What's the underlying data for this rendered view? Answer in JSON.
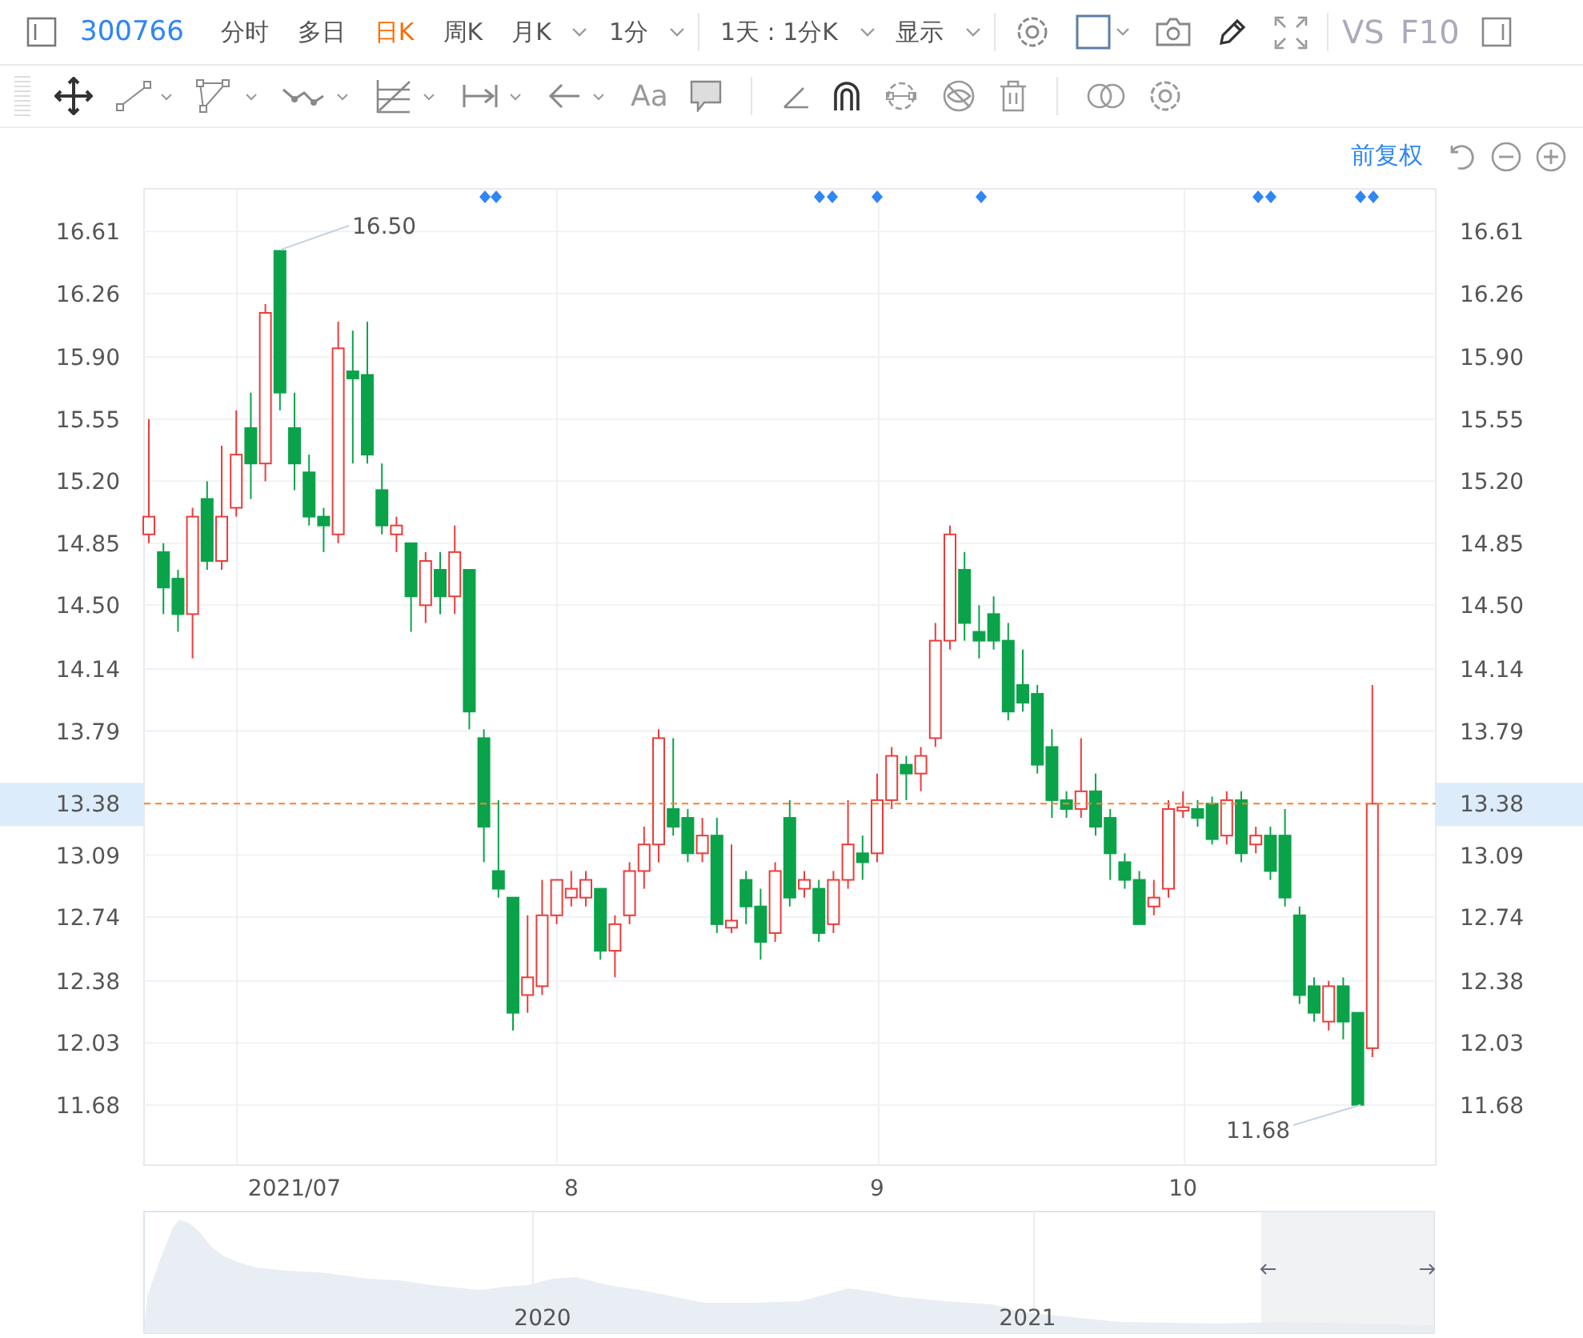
{
  "toolbar": {
    "stock_code": "300766",
    "periods": [
      {
        "label": "分时",
        "selected": false,
        "kind": "tab"
      },
      {
        "label": "多日",
        "selected": false,
        "kind": "tab"
      },
      {
        "label": "日K",
        "selected": true,
        "kind": "tab"
      },
      {
        "label": "周K",
        "selected": false,
        "kind": "tab"
      },
      {
        "label": "月K",
        "selected": false,
        "kind": "dropdown"
      },
      {
        "label": "1分",
        "selected": false,
        "kind": "dropdown"
      }
    ],
    "range": "1天 : 1分K",
    "display": "显示",
    "compare": "VS",
    "f10": "F10"
  },
  "drawing_tools": {
    "text_tool": "Aa"
  },
  "chart": {
    "adjustment": "前复权",
    "right_axis": [
      "16.61",
      "16.26",
      "15.90",
      "15.55",
      "15.20",
      "14.85",
      "14.50",
      "14.14",
      "13.79",
      "13.09",
      "12.74",
      "12.38",
      "12.03",
      "11.68"
    ],
    "left_current_price": "13.38",
    "right_current_price": "13.38",
    "high_label": "16.50",
    "low_label": "11.68",
    "chart_data": {
      "type": "candlestick",
      "categories": [
        null,
        null,
        null,
        null,
        null,
        null,
        null,
        null,
        null,
        null,
        "2021/07",
        null,
        null,
        null,
        null,
        null,
        null,
        null,
        null,
        null,
        null,
        null,
        null,
        null,
        null,
        null,
        null,
        null,
        null,
        "8",
        null,
        null,
        null,
        null,
        null,
        null,
        null,
        null,
        null,
        null,
        null,
        null,
        null,
        null,
        null,
        null,
        null,
        null,
        null,
        null,
        "9",
        null,
        null,
        null,
        null,
        null,
        null,
        null,
        null,
        null,
        null,
        null,
        null,
        null,
        null,
        null,
        null,
        null,
        null,
        null,
        null,
        "10",
        null,
        null,
        null,
        null,
        null,
        null,
        null,
        null,
        null,
        null,
        null,
        null,
        null
      ],
      "ylim": [
        11.34,
        16.85
      ],
      "yticks": [
        {
          "value": 16.61,
          "label": "16.61"
        },
        {
          "value": 16.26,
          "label": "16.26"
        },
        {
          "value": 15.9,
          "label": "15.90"
        },
        {
          "value": 15.55,
          "label": "15.55"
        },
        {
          "value": 15.2,
          "label": "15.20"
        },
        {
          "value": 14.85,
          "label": "14.85"
        },
        {
          "value": 14.5,
          "label": "14.50"
        },
        {
          "value": 14.14,
          "label": "14.14"
        },
        {
          "value": 13.79,
          "label": "13.79"
        },
        {
          "value": 13.09,
          "label": "13.09"
        },
        {
          "value": 12.74,
          "label": "12.74"
        },
        {
          "value": 12.38,
          "label": "12.38"
        },
        {
          "value": 12.03,
          "label": "12.03"
        },
        {
          "value": 11.68,
          "label": "11.68"
        }
      ],
      "ohlc": [
        [
          14.9,
          15.55,
          14.85,
          15.0
        ],
        [
          14.8,
          14.85,
          14.45,
          14.6
        ],
        [
          14.65,
          14.7,
          14.35,
          14.45
        ],
        [
          14.45,
          15.05,
          14.2,
          15.0
        ],
        [
          15.1,
          15.2,
          14.7,
          14.75
        ],
        [
          14.75,
          15.4,
          14.7,
          15.0
        ],
        [
          15.05,
          15.6,
          15.0,
          15.35
        ],
        [
          15.5,
          15.7,
          15.1,
          15.3
        ],
        [
          15.3,
          16.2,
          15.2,
          16.15
        ],
        [
          16.5,
          16.5,
          15.6,
          15.7
        ],
        [
          15.5,
          15.7,
          15.15,
          15.3
        ],
        [
          15.25,
          15.35,
          14.95,
          15.0
        ],
        [
          15.0,
          15.05,
          14.8,
          14.95
        ],
        [
          14.9,
          16.1,
          14.85,
          15.95
        ],
        [
          15.82,
          16.05,
          15.3,
          15.78
        ],
        [
          15.8,
          16.1,
          15.3,
          15.35
        ],
        [
          15.15,
          15.3,
          14.9,
          14.95
        ],
        [
          14.9,
          15.0,
          14.8,
          14.95
        ],
        [
          14.85,
          14.85,
          14.35,
          14.55
        ],
        [
          14.5,
          14.8,
          14.4,
          14.75
        ],
        [
          14.7,
          14.8,
          14.45,
          14.55
        ],
        [
          14.55,
          14.95,
          14.45,
          14.8
        ],
        [
          14.7,
          14.7,
          13.8,
          13.9
        ],
        [
          13.75,
          13.8,
          13.05,
          13.25
        ],
        [
          13.0,
          13.4,
          12.85,
          12.9
        ],
        [
          12.85,
          12.85,
          12.1,
          12.2
        ],
        [
          12.3,
          12.75,
          12.2,
          12.4
        ],
        [
          12.35,
          12.95,
          12.3,
          12.75
        ],
        [
          12.75,
          12.95,
          12.7,
          12.95
        ],
        [
          12.85,
          13.0,
          12.8,
          12.9
        ],
        [
          12.85,
          13.0,
          12.8,
          12.95
        ],
        [
          12.9,
          12.9,
          12.5,
          12.55
        ],
        [
          12.55,
          12.75,
          12.4,
          12.7
        ],
        [
          12.75,
          13.05,
          12.7,
          13.0
        ],
        [
          13.0,
          13.25,
          12.9,
          13.15
        ],
        [
          13.15,
          13.8,
          13.05,
          13.75
        ],
        [
          13.35,
          13.75,
          13.2,
          13.25
        ],
        [
          13.3,
          13.35,
          13.05,
          13.1
        ],
        [
          13.1,
          13.3,
          13.05,
          13.2
        ],
        [
          13.2,
          13.3,
          12.65,
          12.7
        ],
        [
          12.68,
          13.15,
          12.65,
          12.72
        ],
        [
          12.95,
          13.0,
          12.7,
          12.8
        ],
        [
          12.8,
          12.9,
          12.5,
          12.6
        ],
        [
          12.65,
          13.05,
          12.6,
          13.0
        ],
        [
          13.3,
          13.4,
          12.8,
          12.85
        ],
        [
          12.9,
          13.0,
          12.85,
          12.95
        ],
        [
          12.9,
          12.95,
          12.6,
          12.65
        ],
        [
          12.7,
          13.0,
          12.65,
          12.95
        ],
        [
          12.95,
          13.4,
          12.9,
          13.15
        ],
        [
          13.1,
          13.2,
          12.95,
          13.05
        ],
        [
          13.1,
          13.55,
          13.05,
          13.4
        ],
        [
          13.4,
          13.7,
          13.35,
          13.65
        ],
        [
          13.6,
          13.65,
          13.4,
          13.55
        ],
        [
          13.55,
          13.7,
          13.45,
          13.65
        ],
        [
          13.75,
          14.4,
          13.7,
          14.3
        ],
        [
          14.3,
          14.95,
          14.25,
          14.9
        ],
        [
          14.7,
          14.8,
          14.3,
          14.4
        ],
        [
          14.35,
          14.5,
          14.2,
          14.3
        ],
        [
          14.45,
          14.55,
          14.25,
          14.3
        ],
        [
          14.3,
          14.4,
          13.85,
          13.9
        ],
        [
          14.05,
          14.25,
          13.9,
          13.95
        ],
        [
          14.0,
          14.05,
          13.55,
          13.6
        ],
        [
          13.7,
          13.8,
          13.3,
          13.4
        ],
        [
          13.4,
          13.45,
          13.3,
          13.35
        ],
        [
          13.35,
          13.75,
          13.3,
          13.45
        ],
        [
          13.45,
          13.55,
          13.2,
          13.25
        ],
        [
          13.3,
          13.35,
          12.95,
          13.1
        ],
        [
          13.05,
          13.1,
          12.9,
          12.95
        ],
        [
          12.95,
          13.0,
          12.7,
          12.7
        ],
        [
          12.8,
          12.95,
          12.75,
          12.85
        ],
        [
          12.9,
          13.4,
          12.85,
          13.35
        ],
        [
          13.34,
          13.45,
          13.3,
          13.36
        ],
        [
          13.35,
          13.4,
          13.25,
          13.3
        ],
        [
          13.38,
          13.42,
          13.15,
          13.18
        ],
        [
          13.2,
          13.45,
          13.15,
          13.4
        ],
        [
          13.4,
          13.45,
          13.05,
          13.1
        ],
        [
          13.15,
          13.25,
          13.1,
          13.2
        ],
        [
          13.2,
          13.25,
          12.95,
          13.0
        ],
        [
          13.2,
          13.35,
          12.8,
          12.85
        ],
        [
          12.75,
          12.8,
          12.25,
          12.3
        ],
        [
          12.35,
          12.4,
          12.15,
          12.2
        ],
        [
          12.15,
          12.38,
          12.1,
          12.35
        ],
        [
          12.35,
          12.4,
          12.05,
          12.15
        ],
        [
          12.2,
          12.2,
          11.68,
          11.68
        ],
        [
          12.0,
          14.05,
          11.95,
          13.38
        ]
      ]
    }
  },
  "navigator": {
    "year_labels": [
      "2020",
      "2021"
    ]
  }
}
